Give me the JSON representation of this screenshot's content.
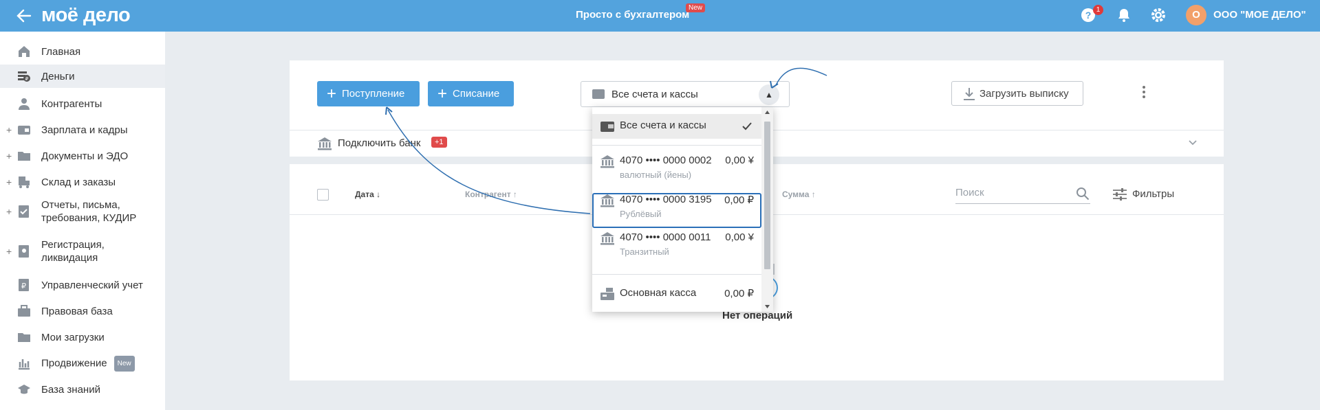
{
  "header": {
    "logo": "моё дело",
    "center_title": "Просто с бухгалтером",
    "center_badge": "New",
    "help_label": "?",
    "help_count": "1",
    "avatar_letter": "О",
    "company_name": "ООО \"МОЕ ДЕЛО\""
  },
  "sidebar": {
    "items": [
      {
        "label": "Главная",
        "icon": "home-icon"
      },
      {
        "label": "Деньги",
        "icon": "money-icon",
        "active": true
      },
      {
        "label": "Контрагенты",
        "icon": "contractors-icon"
      },
      {
        "label": "Зарплата и кадры",
        "icon": "salary-icon",
        "expandable": true
      },
      {
        "label": "Документы и ЭДО",
        "icon": "folder-icon",
        "expandable": true
      },
      {
        "label": "Склад и заказы",
        "icon": "warehouse-icon",
        "expandable": true
      },
      {
        "label_line1": "Отчеты, письма,",
        "label_line2": "требования, КУДИР",
        "icon": "reports-icon",
        "expandable": true
      },
      {
        "label_line1": "Регистрация,",
        "label_line2": "ликвидация",
        "icon": "registration-icon",
        "expandable": true
      },
      {
        "label": "Управленческий учет",
        "icon": "management-icon"
      },
      {
        "label": "Правовая база",
        "icon": "briefcase-icon"
      },
      {
        "label": "Мои загрузки",
        "icon": "folder-icon"
      },
      {
        "label": "Продвижение",
        "icon": "promo-icon",
        "badge": "New"
      },
      {
        "label": "База знаний",
        "icon": "graduation-icon"
      }
    ]
  },
  "toolbar": {
    "income_label": "Поступление",
    "expense_label": "Списание",
    "accounts_select_label": "Все счета и кассы",
    "upload_label": "Загрузить выписку"
  },
  "bank": {
    "connect_label": "Подключить банк",
    "connect_badge": "+1"
  },
  "table": {
    "col_date": "Дата ↓",
    "col_contractor": "Контрагент ↑",
    "col_sum": "Сумма ↑",
    "search_placeholder": "Поиск",
    "filters_label": "Фильтры",
    "empty_text": "Нет операций"
  },
  "dropdown": {
    "all_label": "Все счета и кассы",
    "accounts": [
      {
        "number": "4070 •••• 0000 0002",
        "amount": "0,00 ¥",
        "sub": "валютный (йены)"
      },
      {
        "number": "4070 •••• 0000 3195",
        "amount": "0,00 ₽",
        "sub": "Рублёвый",
        "highlighted": true
      },
      {
        "number": "4070 •••• 0000 0011",
        "amount": "0,00 ¥",
        "sub": "Транзитный"
      }
    ],
    "cash_label": "Основная касса",
    "cash_amount": "0,00 ₽"
  },
  "colors": {
    "header_bg": "#53a3dd",
    "primary_button": "#4a9ede",
    "badge_red": "#e04b4b",
    "highlight_outline": "#2a6fb8"
  }
}
